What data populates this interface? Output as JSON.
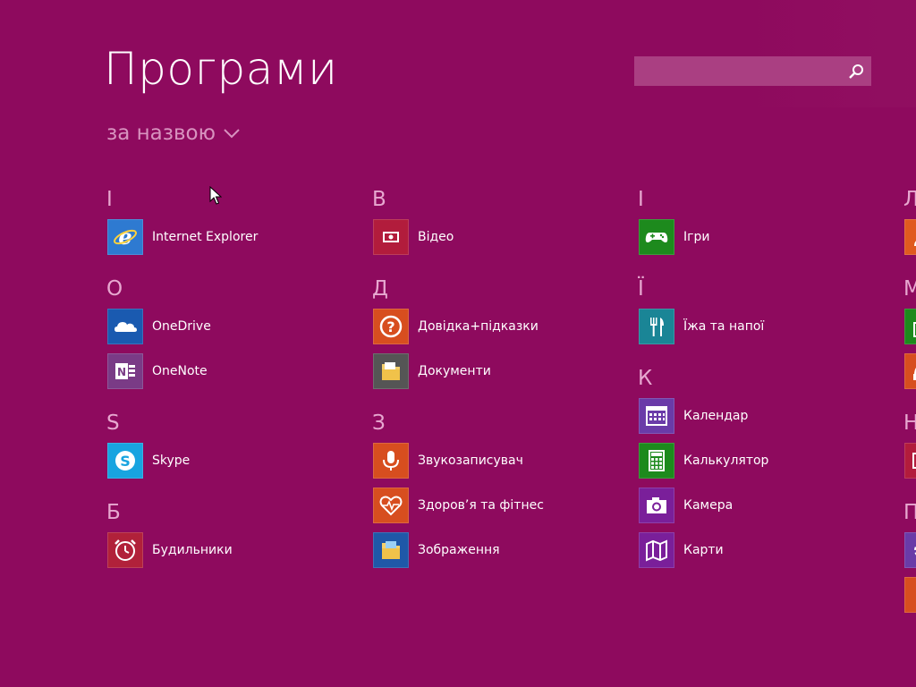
{
  "header": {
    "title": "Програми",
    "sort_label": "за назвою"
  },
  "search": {
    "placeholder": ""
  },
  "groups": [
    {
      "letter": "I"
    },
    {
      "letter": "O"
    },
    {
      "letter": "S"
    },
    {
      "letter": "Б"
    },
    {
      "letter": "В"
    },
    {
      "letter": "Д"
    },
    {
      "letter": "З"
    },
    {
      "letter": "І"
    },
    {
      "letter": "Ї"
    },
    {
      "letter": "К"
    },
    {
      "letter": "Л"
    },
    {
      "letter": "М"
    },
    {
      "letter": "Н"
    },
    {
      "letter": "П"
    }
  ],
  "apps": [
    {
      "label": "Internet Explorer",
      "icon": "internet-explorer-icon",
      "color": "#2e7ad1"
    },
    {
      "label": "OneDrive",
      "icon": "onedrive-icon",
      "color": "#1a5ab0"
    },
    {
      "label": "OneNote",
      "icon": "onenote-icon",
      "color": "#7a3b86"
    },
    {
      "label": "Skype",
      "icon": "skype-icon",
      "color": "#18a4e0"
    },
    {
      "label": "Будильники",
      "icon": "alarm-clock-icon",
      "color": "#b1213a"
    },
    {
      "label": "Відео",
      "icon": "video-icon",
      "color": "#b21c3c"
    },
    {
      "label": "Довідка+підказки",
      "icon": "help-icon",
      "color": "#d74e1f"
    },
    {
      "label": "Документи",
      "icon": "documents-folder-icon",
      "color": "#555555"
    },
    {
      "label": "Звукозаписувач",
      "icon": "microphone-icon",
      "color": "#d74e1f"
    },
    {
      "label": "Здоров’я та фітнес",
      "icon": "heart-pulse-icon",
      "color": "#d74e1f"
    },
    {
      "label": "Зображення",
      "icon": "pictures-folder-icon",
      "color": "#1f58a8"
    },
    {
      "label": "Ігри",
      "icon": "gamepad-icon",
      "color": "#1d8a1d"
    },
    {
      "label": "Їжа та напої",
      "icon": "fork-knife-icon",
      "color": "#1a8596"
    },
    {
      "label": "Календар",
      "icon": "calendar-icon",
      "color": "#6a3ba8"
    },
    {
      "label": "Калькулятор",
      "icon": "calculator-icon",
      "color": "#1d8a1d"
    },
    {
      "label": "Камера",
      "icon": "camera-icon",
      "color": "#7a1f9a"
    },
    {
      "label": "Карти",
      "icon": "map-icon",
      "color": "#7a1f9a"
    }
  ],
  "offscreen_tiles": [
    {
      "icon": "person-icon",
      "color": "#e05a1f"
    },
    {
      "icon": "store-icon",
      "color": "#1d8a1d"
    },
    {
      "icon": "music-icon",
      "color": "#d74e1f"
    },
    {
      "icon": "news-icon",
      "color": "#b21c3c"
    },
    {
      "icon": "settings-icon",
      "color": "#6a3ba8"
    },
    {
      "icon": "app-icon",
      "color": "#d74e1f"
    }
  ]
}
